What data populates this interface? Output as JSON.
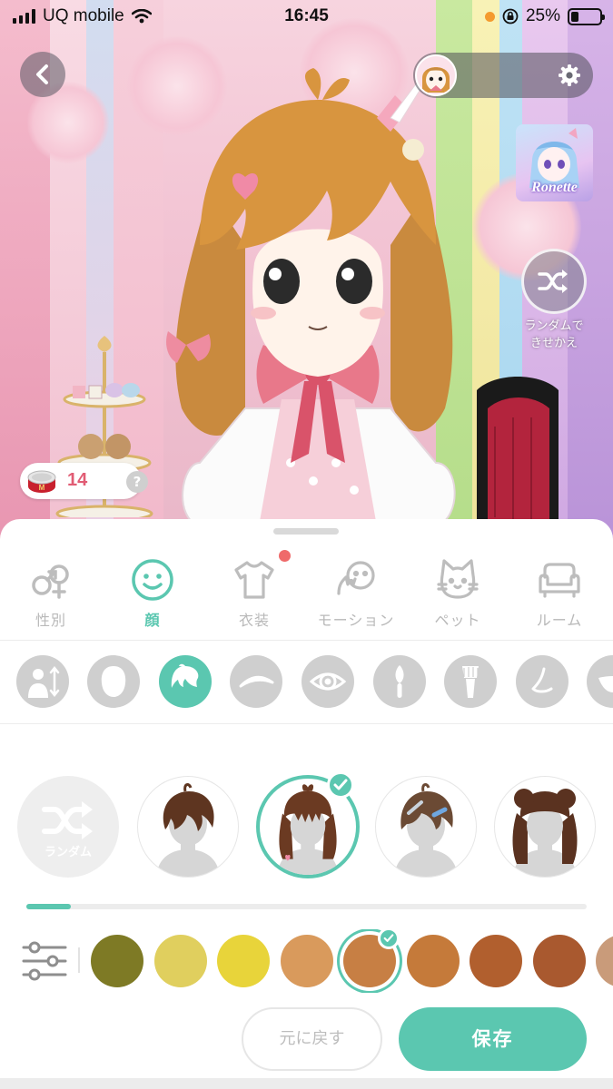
{
  "status_bar": {
    "carrier": "UQ mobile",
    "time": "16:45",
    "battery": "25%",
    "battery_level": 0.25
  },
  "header": {
    "shuffle_label": "ランダムで\nきせかえ",
    "featured_name": "Ronette"
  },
  "currency": {
    "count": "14",
    "help": "?"
  },
  "tabs": [
    {
      "label": "性別",
      "icon": "gender-icon",
      "active": false
    },
    {
      "label": "顔",
      "icon": "face-icon",
      "active": true
    },
    {
      "label": "衣装",
      "icon": "shirt-icon",
      "active": false,
      "badge": true
    },
    {
      "label": "モーション",
      "icon": "motion-icon",
      "active": false
    },
    {
      "label": "ペット",
      "icon": "cat-icon",
      "active": false
    },
    {
      "label": "ルーム",
      "icon": "sofa-icon",
      "active": false
    }
  ],
  "subcategories": [
    {
      "icon": "body-height-icon",
      "active": false
    },
    {
      "icon": "face-shape-icon",
      "active": false
    },
    {
      "icon": "hair-icon",
      "active": true
    },
    {
      "icon": "eyebrow-icon",
      "active": false
    },
    {
      "icon": "eye-icon",
      "active": false
    },
    {
      "icon": "brush-icon",
      "active": false
    },
    {
      "icon": "makeup-brush-icon",
      "active": false
    },
    {
      "icon": "nose-icon",
      "active": false
    },
    {
      "icon": "mouth-icon",
      "active": false
    }
  ],
  "items": {
    "random_label": "ランダム",
    "list": [
      {
        "icon": "hair-tousled-icon",
        "selected": false
      },
      {
        "icon": "hair-bangs-icon",
        "selected": true
      },
      {
        "icon": "hair-clips-icon",
        "selected": false
      },
      {
        "icon": "hair-buns-icon",
        "selected": false
      }
    ],
    "scroll_progress": 0.08
  },
  "colors": {
    "accent": "#5bc7b0",
    "swatches": [
      "#7e7a25",
      "#e0cf5e",
      "#e8d43a",
      "#d99a5c",
      "#c77f44",
      "#c57a3a",
      "#b15f2e",
      "#a9592f",
      "#c99b7a"
    ],
    "selected_index": 4
  },
  "footer": {
    "revert_label": "元に戻す",
    "save_label": "保存"
  }
}
